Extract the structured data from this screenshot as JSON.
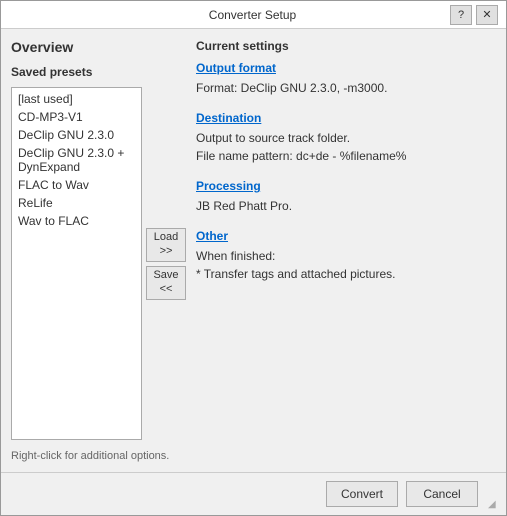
{
  "window": {
    "title": "Converter Setup",
    "help_btn": "?",
    "close_btn": "✕"
  },
  "left_panel": {
    "overview_title": "Overview",
    "saved_presets_label": "Saved presets",
    "presets": [
      {
        "label": "[last used]"
      },
      {
        "label": "CD-MP3-V1"
      },
      {
        "label": "DeClip GNU 2.3.0"
      },
      {
        "label": "DeClip GNU 2.3.0 + DynExpand"
      },
      {
        "label": "FLAC to Wav"
      },
      {
        "label": "ReLife"
      },
      {
        "label": "Wav to FLAC"
      }
    ],
    "load_btn": "Load\n>>",
    "save_btn": "Save\n<<",
    "hint": "Right-click for additional options."
  },
  "right_panel": {
    "current_settings_label": "Current settings",
    "sections": [
      {
        "id": "output-format",
        "link_text": "Output format",
        "lines": [
          "Format: DeClip GNU 2.3.0, -m3000."
        ]
      },
      {
        "id": "destination",
        "link_text": "Destination",
        "lines": [
          "Output to source track folder.",
          "File name pattern: dc+de - %filename%"
        ]
      },
      {
        "id": "processing",
        "link_text": "Processing",
        "lines": [
          "JB Red Phatt Pro."
        ]
      },
      {
        "id": "other",
        "link_text": "Other",
        "lines": [
          "When finished:",
          "* Transfer tags and attached pictures."
        ]
      }
    ]
  },
  "bottom_bar": {
    "convert_btn": "Convert",
    "cancel_btn": "Cancel"
  }
}
